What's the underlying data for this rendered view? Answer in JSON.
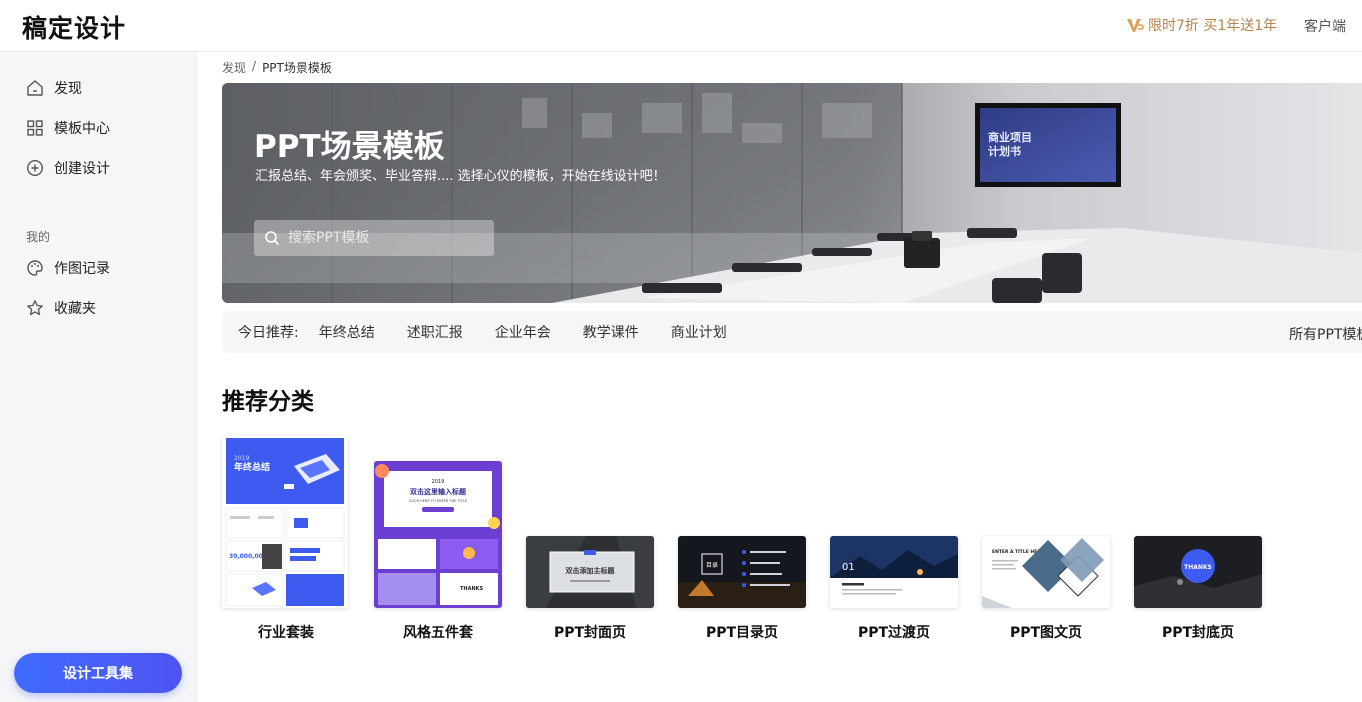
{
  "header": {
    "logo": "稿定设计",
    "vip_text": "限时7折 买1年送1年",
    "client_link": "客户端"
  },
  "sidebar": {
    "items": [
      {
        "label": "发现",
        "icon": "home-icon"
      },
      {
        "label": "模板中心",
        "icon": "grid-icon"
      },
      {
        "label": "创建设计",
        "icon": "plus-circle-icon"
      }
    ],
    "group_label": "我的",
    "my_items": [
      {
        "label": "作图记录",
        "icon": "palette-icon"
      },
      {
        "label": "收藏夹",
        "icon": "star-icon"
      }
    ],
    "tool_button": "设计工具集"
  },
  "breadcrumb": {
    "root": "发现",
    "sep": "/",
    "current": "PPT场景模板"
  },
  "banner": {
    "title": "PPT场景模板",
    "subtitle": "汇报总结、年会颁奖、毕业答辩.... 选择心仪的模板，开始在线设计吧！",
    "search_placeholder": "搜索PPT模板",
    "screen_text_1": "商业项目",
    "screen_text_2": "计划书"
  },
  "recommend": {
    "label": "今日推荐:",
    "tags": [
      "年终总结",
      "述职汇报",
      "企业年会",
      "教学课件",
      "商业计划"
    ],
    "all_link": "所有PPT模板"
  },
  "section_title": "推荐分类",
  "categories": [
    {
      "label": "行业套装",
      "thumb_year": "2019",
      "thumb_title": "年终总结",
      "thumb_number": "30,000,000"
    },
    {
      "label": "风格五件套",
      "thumb_year": "2019",
      "thumb_title": "双击这里输入标题",
      "thumb_sub": "CLICK HERE TO ENTER THE TITLE",
      "thumb_thanks": "THANKS"
    },
    {
      "label": "PPT封面页",
      "thumb_title": "双击添加主标题"
    },
    {
      "label": "PPT目录页",
      "thumb_title": "目录"
    },
    {
      "label": "PPT过渡页",
      "thumb_title": "01"
    },
    {
      "label": "PPT图文页",
      "thumb_title": "ENTER A TITLE HERE"
    },
    {
      "label": "PPT封底页",
      "thumb_title": "THANKS"
    }
  ],
  "colors": {
    "accent": "#3f6bff",
    "vip": "#b8834a",
    "sidebar_bg": "#f5f6f8"
  }
}
